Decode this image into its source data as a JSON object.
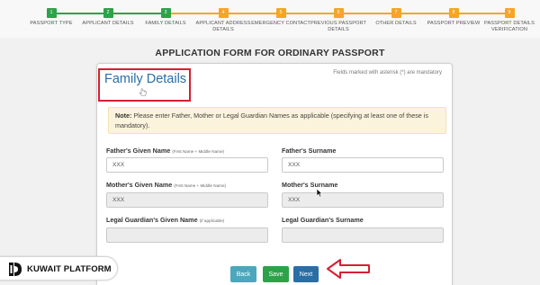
{
  "stepper": {
    "steps": [
      {
        "number": "1",
        "label": "PASSPORT TYPE",
        "status": "done"
      },
      {
        "number": "2",
        "label": "APPLICANT DETAILS",
        "status": "done"
      },
      {
        "number": "3",
        "label": "FAMILY DETAILS",
        "status": "current"
      },
      {
        "number": "4",
        "label": "APPLICANT ADDRESS DETAILS",
        "status": "pending"
      },
      {
        "number": "5",
        "label": "EMERGENCY CONTACT",
        "status": "pending"
      },
      {
        "number": "6",
        "label": "PREVIOUS PASSPORT DETAILS",
        "status": "pending"
      },
      {
        "number": "7",
        "label": "OTHER DETAILS",
        "status": "pending"
      },
      {
        "number": "8",
        "label": "PASSPORT PREVIEW",
        "status": "pending"
      },
      {
        "number": "9",
        "label": "PASSPORT DETAILS VERIFICATION",
        "status": "pending"
      }
    ]
  },
  "form": {
    "title": "APPLICATION FORM FOR ORDINARY PASSPORT",
    "mandatory_note": "Fields marked with asterisk (*) are mandatory",
    "section_title": "Family Details",
    "note_label": "Note:",
    "note_text": "Please enter Father, Mother or Legal Guardian Names as applicable (specifying at least one of these is mandatory).",
    "fields": {
      "father_given": {
        "label": "Father's Given Name",
        "hint": "(First Name + Middle Name)",
        "value": "XXX"
      },
      "father_surname": {
        "label": "Father's Surname",
        "value": "XXX"
      },
      "mother_given": {
        "label": "Mother's Given Name",
        "hint": "(First Name + Middle Name)",
        "value": "XXX"
      },
      "mother_surname": {
        "label": "Mother's Surname",
        "value": "XXX"
      },
      "guardian_given": {
        "label": "Legal Guardian's Given Name",
        "hint": "(If applicable)",
        "value": ""
      },
      "guardian_surname": {
        "label": "Legal Guardian's Surname",
        "value": ""
      }
    },
    "buttons": {
      "back": "Back",
      "save": "Save",
      "next": "Next"
    }
  },
  "watermark": {
    "text": "KUWAIT PLATFORM"
  },
  "colors": {
    "step_done": "#2ea24a",
    "step_pending": "#f5a623",
    "section_title": "#2a6ea6",
    "highlight": "#d71f32"
  },
  "icons": [
    "hand-cursor-icon",
    "mouse-pointer-icon",
    "red-arrow-icon",
    "kuwait-platform-logo-icon"
  ]
}
